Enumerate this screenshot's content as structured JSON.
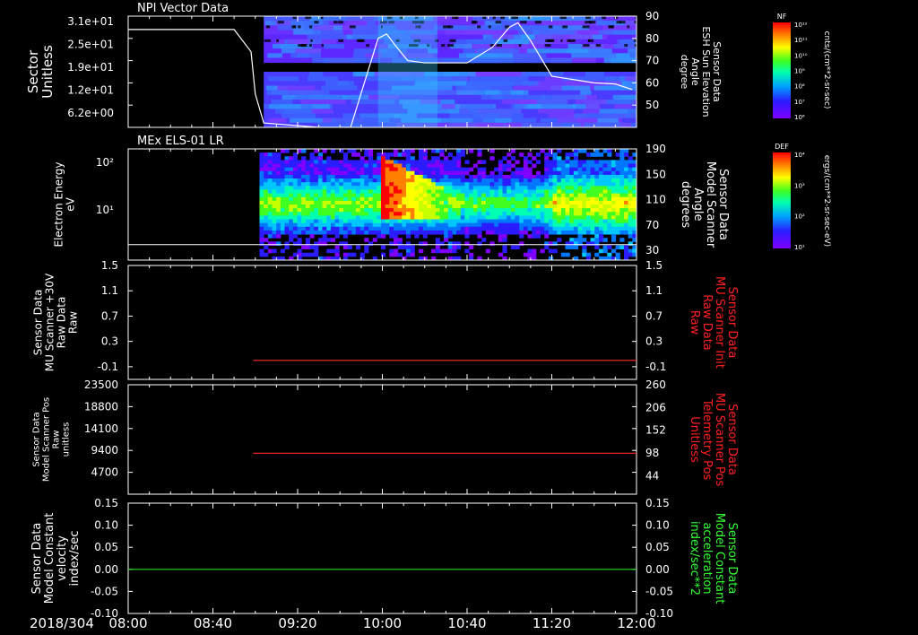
{
  "time_axis": {
    "date_label": "2018/304",
    "range": [
      "08:00",
      "12:00"
    ],
    "ticks": [
      "08:00",
      "08:40",
      "09:20",
      "10:00",
      "10:40",
      "11:20",
      "12:00"
    ]
  },
  "chart_data": [
    {
      "type": "heatmap",
      "title": "NPI Vector Data",
      "ylabel": "Sector\nUnitless",
      "ytick_labels": [
        "3.1e+01",
        "2.5e+01",
        "1.9e+01",
        "1.2e+01",
        "6.2e+00"
      ],
      "y2label": "Sensor Data\nESH Sun Elevation\nAngle\ndegree",
      "y2lim": [
        40,
        90
      ],
      "y2tick_labels": [
        "90",
        "80",
        "70",
        "60",
        "50"
      ],
      "data_start": "09:04",
      "colorbar": {
        "label": "NF",
        "unit": "cnts/(cm**2-sr-sec)",
        "tick_labels": [
          "10¹²",
          "10¹¹",
          "10¹⁰",
          "10⁹",
          "10⁸",
          "10⁷",
          "10⁶"
        ]
      },
      "overlay_line": {
        "name": "ESH Sun Elevation Angle",
        "color": "#ffffff",
        "x": [
          "08:00",
          "08:50",
          "08:58",
          "09:00",
          "09:04",
          "09:30",
          "09:45",
          "09:58",
          "10:02",
          "10:06",
          "10:12",
          "10:20",
          "10:40",
          "10:52",
          "11:00",
          "11:04",
          "11:10",
          "11:20",
          "11:40",
          "11:50",
          "11:58"
        ],
        "y": [
          84,
          84,
          74,
          55,
          42,
          40,
          40,
          80,
          82,
          77,
          70,
          69,
          69,
          76,
          85,
          87,
          79,
          63,
          60,
          59.5,
          57
        ]
      }
    },
    {
      "type": "heatmap",
      "title": "MEx ELS-01 LR",
      "ylabel": "Electron Energy\neV",
      "yscale": "log",
      "ytick_labels": [
        "10²",
        "10¹"
      ],
      "y2label": "Sensor Data\nModel Scanner\nAngle\ndegrees",
      "y2lim": [
        0,
        190
      ],
      "y2tick_labels": [
        "190",
        "150",
        "110",
        "70",
        "30"
      ],
      "data_start": "09:02",
      "colorbar": {
        "label": "DEF",
        "unit": "ergs/(cm**2-sr-sec-eV)",
        "tick_labels": [
          "10⁴",
          "10³",
          "10²",
          "10¹"
        ]
      },
      "overlay_line": {
        "name": "Model Scanner Angle",
        "color": "#ffffff",
        "x": [
          "08:00",
          "12:00"
        ],
        "y": [
          2,
          2
        ]
      }
    },
    {
      "type": "line",
      "ylabel": "Sensor Data\nMU Scanner +30V\nRaw Data\nRaw",
      "ylim": [
        -0.3,
        1.5
      ],
      "ytick_labels": [
        "1.5",
        "1.1",
        "0.7",
        "0.3",
        "-0.1"
      ],
      "y2label": "Sensor Data\nMU Scanner Init\nRaw Data\nRaw",
      "y2label_color": "#ff2020",
      "y2lim": [
        -0.3,
        1.5
      ],
      "y2tick_labels": [
        "1.5",
        "1.1",
        "0.7",
        "0.3",
        "-0.1"
      ],
      "series": [
        {
          "color": "#ff2a2a",
          "x": [
            "08:59",
            "12:00"
          ],
          "y": [
            0,
            0
          ]
        }
      ]
    },
    {
      "type": "line",
      "ylabel": "Sensor Data\nModel Scanner Pos\nRaw\nunitless",
      "ylim": [
        0,
        23500
      ],
      "ytick_labels": [
        "23500",
        "18800",
        "14100",
        "9400",
        "4700"
      ],
      "y2label": "Sensor Data\nMU Scanner Pos\nTelemetry Pos\nUnitless",
      "y2label_color": "#ff2020",
      "y2lim": [
        0,
        260
      ],
      "y2tick_labels": [
        "260",
        "206",
        "152",
        "98",
        "44"
      ],
      "series": [
        {
          "color": "#ff2a2a",
          "x": [
            "08:59",
            "12:00"
          ],
          "y": [
            8800,
            8800
          ]
        }
      ]
    },
    {
      "type": "line",
      "ylabel": "Sensor Data\nModel Constant\nvelocity\nindex/sec",
      "ylim": [
        -0.1,
        0.15
      ],
      "ytick_labels": [
        "0.15",
        "0.10",
        "0.05",
        "0.00",
        "-0.05",
        "-0.10"
      ],
      "y2label": "Sensor Data\nModel Constant\nacceleration\nindex/sec**2",
      "y2label_color": "#33ff33",
      "y2lim": [
        -0.1,
        0.15
      ],
      "y2tick_labels": [
        "0.15",
        "0.10",
        "0.05",
        "0.00",
        "-0.05",
        "-0.10"
      ],
      "series": [
        {
          "color": "#22dd22",
          "x": [
            "08:00",
            "12:00"
          ],
          "y": [
            0,
            0
          ]
        }
      ]
    }
  ]
}
